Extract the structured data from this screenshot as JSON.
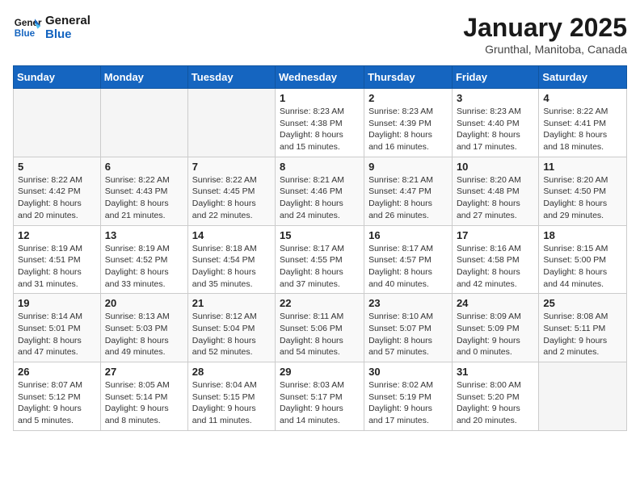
{
  "logo": {
    "line1": "General",
    "line2": "Blue"
  },
  "calendar": {
    "title": "January 2025",
    "subtitle": "Grunthal, Manitoba, Canada",
    "days_of_week": [
      "Sunday",
      "Monday",
      "Tuesday",
      "Wednesday",
      "Thursday",
      "Friday",
      "Saturday"
    ],
    "weeks": [
      [
        {
          "day": "",
          "info": ""
        },
        {
          "day": "",
          "info": ""
        },
        {
          "day": "",
          "info": ""
        },
        {
          "day": "1",
          "info": "Sunrise: 8:23 AM\nSunset: 4:38 PM\nDaylight: 8 hours\nand 15 minutes."
        },
        {
          "day": "2",
          "info": "Sunrise: 8:23 AM\nSunset: 4:39 PM\nDaylight: 8 hours\nand 16 minutes."
        },
        {
          "day": "3",
          "info": "Sunrise: 8:23 AM\nSunset: 4:40 PM\nDaylight: 8 hours\nand 17 minutes."
        },
        {
          "day": "4",
          "info": "Sunrise: 8:22 AM\nSunset: 4:41 PM\nDaylight: 8 hours\nand 18 minutes."
        }
      ],
      [
        {
          "day": "5",
          "info": "Sunrise: 8:22 AM\nSunset: 4:42 PM\nDaylight: 8 hours\nand 20 minutes."
        },
        {
          "day": "6",
          "info": "Sunrise: 8:22 AM\nSunset: 4:43 PM\nDaylight: 8 hours\nand 21 minutes."
        },
        {
          "day": "7",
          "info": "Sunrise: 8:22 AM\nSunset: 4:45 PM\nDaylight: 8 hours\nand 22 minutes."
        },
        {
          "day": "8",
          "info": "Sunrise: 8:21 AM\nSunset: 4:46 PM\nDaylight: 8 hours\nand 24 minutes."
        },
        {
          "day": "9",
          "info": "Sunrise: 8:21 AM\nSunset: 4:47 PM\nDaylight: 8 hours\nand 26 minutes."
        },
        {
          "day": "10",
          "info": "Sunrise: 8:20 AM\nSunset: 4:48 PM\nDaylight: 8 hours\nand 27 minutes."
        },
        {
          "day": "11",
          "info": "Sunrise: 8:20 AM\nSunset: 4:50 PM\nDaylight: 8 hours\nand 29 minutes."
        }
      ],
      [
        {
          "day": "12",
          "info": "Sunrise: 8:19 AM\nSunset: 4:51 PM\nDaylight: 8 hours\nand 31 minutes."
        },
        {
          "day": "13",
          "info": "Sunrise: 8:19 AM\nSunset: 4:52 PM\nDaylight: 8 hours\nand 33 minutes."
        },
        {
          "day": "14",
          "info": "Sunrise: 8:18 AM\nSunset: 4:54 PM\nDaylight: 8 hours\nand 35 minutes."
        },
        {
          "day": "15",
          "info": "Sunrise: 8:17 AM\nSunset: 4:55 PM\nDaylight: 8 hours\nand 37 minutes."
        },
        {
          "day": "16",
          "info": "Sunrise: 8:17 AM\nSunset: 4:57 PM\nDaylight: 8 hours\nand 40 minutes."
        },
        {
          "day": "17",
          "info": "Sunrise: 8:16 AM\nSunset: 4:58 PM\nDaylight: 8 hours\nand 42 minutes."
        },
        {
          "day": "18",
          "info": "Sunrise: 8:15 AM\nSunset: 5:00 PM\nDaylight: 8 hours\nand 44 minutes."
        }
      ],
      [
        {
          "day": "19",
          "info": "Sunrise: 8:14 AM\nSunset: 5:01 PM\nDaylight: 8 hours\nand 47 minutes."
        },
        {
          "day": "20",
          "info": "Sunrise: 8:13 AM\nSunset: 5:03 PM\nDaylight: 8 hours\nand 49 minutes."
        },
        {
          "day": "21",
          "info": "Sunrise: 8:12 AM\nSunset: 5:04 PM\nDaylight: 8 hours\nand 52 minutes."
        },
        {
          "day": "22",
          "info": "Sunrise: 8:11 AM\nSunset: 5:06 PM\nDaylight: 8 hours\nand 54 minutes."
        },
        {
          "day": "23",
          "info": "Sunrise: 8:10 AM\nSunset: 5:07 PM\nDaylight: 8 hours\nand 57 minutes."
        },
        {
          "day": "24",
          "info": "Sunrise: 8:09 AM\nSunset: 5:09 PM\nDaylight: 9 hours\nand 0 minutes."
        },
        {
          "day": "25",
          "info": "Sunrise: 8:08 AM\nSunset: 5:11 PM\nDaylight: 9 hours\nand 2 minutes."
        }
      ],
      [
        {
          "day": "26",
          "info": "Sunrise: 8:07 AM\nSunset: 5:12 PM\nDaylight: 9 hours\nand 5 minutes."
        },
        {
          "day": "27",
          "info": "Sunrise: 8:05 AM\nSunset: 5:14 PM\nDaylight: 9 hours\nand 8 minutes."
        },
        {
          "day": "28",
          "info": "Sunrise: 8:04 AM\nSunset: 5:15 PM\nDaylight: 9 hours\nand 11 minutes."
        },
        {
          "day": "29",
          "info": "Sunrise: 8:03 AM\nSunset: 5:17 PM\nDaylight: 9 hours\nand 14 minutes."
        },
        {
          "day": "30",
          "info": "Sunrise: 8:02 AM\nSunset: 5:19 PM\nDaylight: 9 hours\nand 17 minutes."
        },
        {
          "day": "31",
          "info": "Sunrise: 8:00 AM\nSunset: 5:20 PM\nDaylight: 9 hours\nand 20 minutes."
        },
        {
          "day": "",
          "info": ""
        }
      ]
    ]
  }
}
